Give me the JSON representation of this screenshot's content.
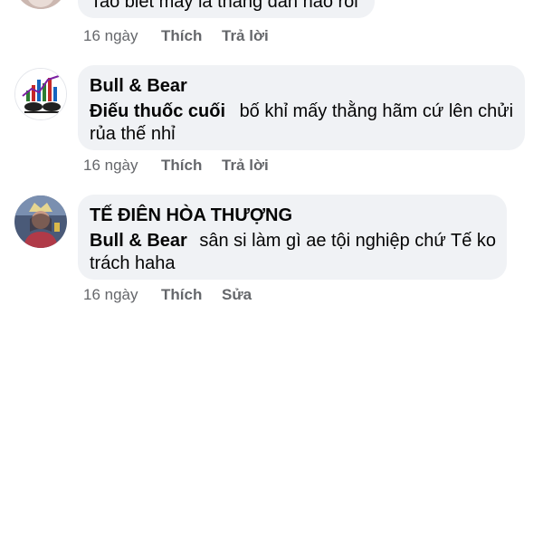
{
  "comments": [
    {
      "text": "Tao biết mày là thằng dần nào rồi",
      "meta": {
        "time": "16 ngày",
        "like": "Thích",
        "action": "Trả lời"
      }
    },
    {
      "author": "Bull & Bear",
      "mention": "Điếu thuốc cuối",
      "text": "bố khỉ mấy thằng hãm cứ lên chửi rủa thế nhỉ",
      "meta": {
        "time": "16 ngày",
        "like": "Thích",
        "action": "Trả lời"
      }
    },
    {
      "author": "TẾ ĐIÊN HÒA THƯỢNG",
      "mention": "Bull & Bear",
      "text": "sân si làm gì ae tội nghiệp chứ Tế ko trách haha",
      "meta": {
        "time": "16 ngày",
        "like": "Thích",
        "action": "Sửa"
      }
    }
  ],
  "colors": {
    "bubble": "#f0f2f5",
    "meta_text": "#65676b",
    "primary_text": "#050505"
  }
}
